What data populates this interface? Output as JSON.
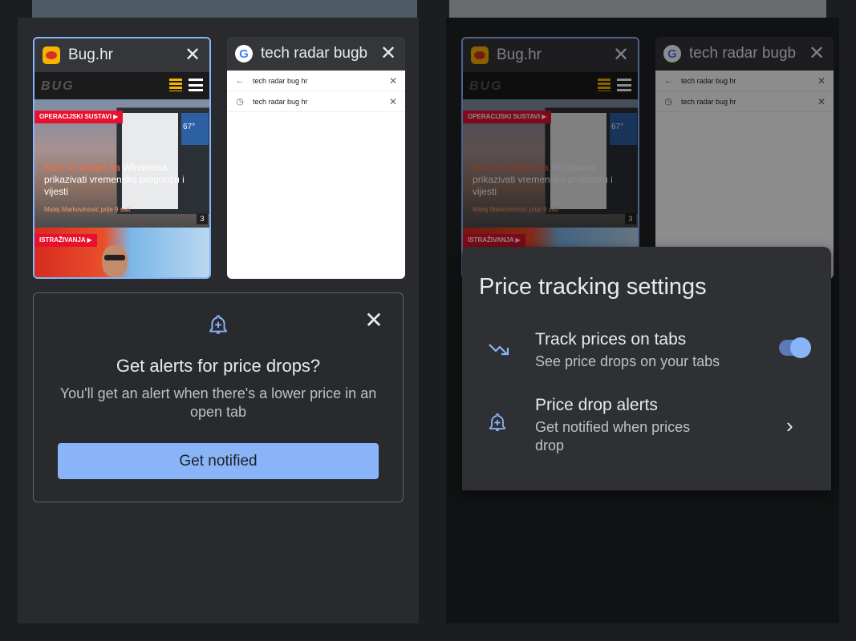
{
  "left_panel": {
    "tabs": [
      {
        "title": "Bug.hr",
        "favicon": "bug-hr-favicon",
        "close": "✕"
      },
      {
        "title": "tech radar bugb",
        "favicon": "google-favicon",
        "close": "✕"
      }
    ],
    "bug_thumb": {
      "logo": "BUG",
      "tag1": "OPERACIJSKI SUSTAVI ▶",
      "headline_highlight": "Novi će widget na",
      "headline_rest": "Windowsa prikazivati vremensku prognozu i vijesti",
      "author": "Matej Markovinović prije 9 sati",
      "weather": "67°",
      "count": "3",
      "tag2": "ISTRAŽIVANJA ▶"
    },
    "google_thumb": {
      "suggestions": [
        {
          "text": "tech radar bug hr",
          "icon": "←"
        },
        {
          "text": "tech radar bug hr",
          "icon": "◷"
        }
      ]
    },
    "promo": {
      "title": "Get alerts for price drops?",
      "description": "You'll get an alert when there's a lower price in an open tab",
      "button": "Get notified",
      "close": "✕"
    }
  },
  "settings_sheet": {
    "title": "Price tracking settings",
    "rows": [
      {
        "title": "Track prices on tabs",
        "subtitle": "See price drops on your tabs",
        "icon": "trending-down-icon",
        "control": "toggle",
        "enabled": true
      },
      {
        "title": "Price drop alerts",
        "subtitle": "Get notified when prices drop",
        "icon": "bell-plus-icon",
        "control": "chevron",
        "chevron": "›"
      }
    ]
  },
  "colors": {
    "accent": "#8ab4f8",
    "panel": "#292a2e",
    "sheet": "#2f3033",
    "tag_red": "#e8112d"
  }
}
